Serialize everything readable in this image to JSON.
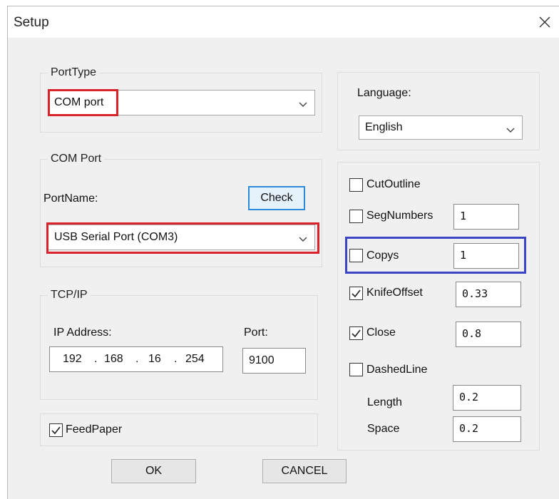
{
  "window": {
    "title": "Setup"
  },
  "port_type": {
    "legend": "PortType",
    "selected": "COM port"
  },
  "language": {
    "label": "Language:",
    "selected": "English"
  },
  "com_port": {
    "legend": "COM Port",
    "port_name_label": "PortName:",
    "check_label": "Check",
    "port_selected": "USB Serial Port (COM3)"
  },
  "tcp_ip": {
    "legend": "TCP/IP",
    "ip_label": "IP Address:",
    "ip": [
      "192",
      "168",
      "16",
      "254"
    ],
    "port_label": "Port:",
    "port_value": "9100"
  },
  "feed_paper": {
    "label": "FeedPaper",
    "checked": true
  },
  "options": {
    "cut_outline": {
      "label": "CutOutline",
      "checked": false
    },
    "seg_numbers": {
      "label": "SegNumbers",
      "checked": false,
      "value": "1"
    },
    "copys": {
      "label": "Copys",
      "checked": false,
      "value": "1"
    },
    "knife_offset": {
      "label": "KnifeOffset",
      "checked": true,
      "value": "0.33"
    },
    "close": {
      "label": "Close",
      "checked": true,
      "value": "0.8"
    },
    "dashed_line": {
      "label": "DashedLine",
      "checked": false
    },
    "length": {
      "label": "Length",
      "value": "0.2"
    },
    "space": {
      "label": "Space",
      "value": "0.2"
    }
  },
  "buttons": {
    "ok": "OK",
    "cancel": "CANCEL"
  },
  "highlight_colors": {
    "red": "#d8232a",
    "blue": "#3a46c4"
  }
}
